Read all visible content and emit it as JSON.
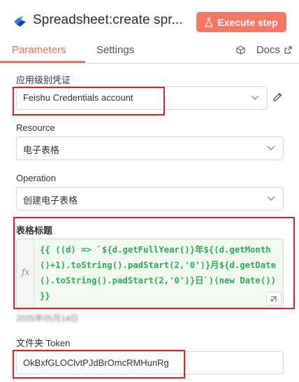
{
  "header": {
    "title": "Spreadsheet:create spr...",
    "execute_label": "Execute step",
    "icon": "bird-logo-icon"
  },
  "tabs": [
    {
      "label": "Parameters",
      "active": true
    },
    {
      "label": "Settings",
      "active": false
    }
  ],
  "docs": {
    "label": "Docs",
    "icons": [
      "cube-icon",
      "external-link-icon"
    ]
  },
  "fields": {
    "credential": {
      "label": "应用级别凭证",
      "value": "Feishu Credentials account"
    },
    "resource": {
      "label": "Resource",
      "value": "电子表格"
    },
    "operation": {
      "label": "Operation",
      "value": "创建电子表格"
    },
    "title_field": {
      "label": "表格标题",
      "expression": "{{ ((d) => `${d.getFullYear()}年${(d.getMonth()+1).toString().padStart(2,'0')}月${d.getDate().toString().padStart(2,'0')}日`)(new Date()) }}",
      "result": "2025年05月14日"
    },
    "folder_token": {
      "label": "文件夹 Token",
      "value": "OkBxfGLOClvtPJdBrOmcRMHunRg"
    }
  },
  "colors": {
    "accent": "#f26d58",
    "button": "#fd7664",
    "highlight": "#d32525",
    "expression_text": "#2ea95a"
  }
}
